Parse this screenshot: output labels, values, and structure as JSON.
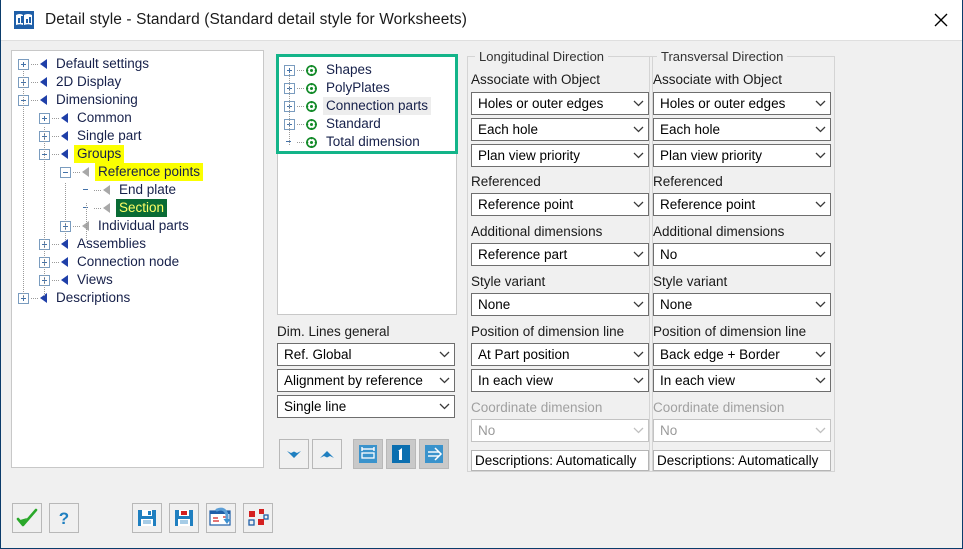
{
  "window": {
    "title": "Detail style - Standard (Standard detail style for Worksheets)",
    "icon": "book-chart-icon",
    "close_label": "×",
    "accent_green": "#13b489",
    "highlight_yellow": "#fbff00",
    "selection_green": "#0a6b35",
    "tree_text_color": "#16204a"
  },
  "tree": {
    "name": "settings-tree",
    "items": [
      {
        "label": "Default settings",
        "depth": 0,
        "expander": "plus",
        "marker": "blue-triangle",
        "highlight": "none"
      },
      {
        "label": "2D Display",
        "depth": 0,
        "expander": "plus",
        "marker": "blue-triangle",
        "highlight": "none"
      },
      {
        "label": "Dimensioning",
        "depth": 0,
        "expander": "minus",
        "marker": "blue-triangle",
        "highlight": "none"
      },
      {
        "label": "Common",
        "depth": 1,
        "expander": "plus",
        "marker": "blue-triangle",
        "highlight": "none"
      },
      {
        "label": "Single part",
        "depth": 1,
        "expander": "plus",
        "marker": "blue-triangle",
        "highlight": "none"
      },
      {
        "label": "Groups",
        "depth": 1,
        "expander": "minus",
        "marker": "blue-triangle",
        "highlight": "yellow"
      },
      {
        "label": "Reference points",
        "depth": 2,
        "expander": "minus",
        "marker": "gray-triangle",
        "highlight": "yellow"
      },
      {
        "label": "End plate",
        "depth": 3,
        "expander": "none",
        "marker": "gray-triangle",
        "highlight": "none"
      },
      {
        "label": "Section",
        "depth": 3,
        "expander": "none",
        "marker": "gray-triangle",
        "highlight": "green"
      },
      {
        "label": "Individual parts",
        "depth": 2,
        "expander": "plus",
        "marker": "gray-triangle",
        "highlight": "none"
      },
      {
        "label": "Assemblies",
        "depth": 1,
        "expander": "plus",
        "marker": "blue-triangle",
        "highlight": "none"
      },
      {
        "label": "Connection node",
        "depth": 1,
        "expander": "plus",
        "marker": "blue-triangle",
        "highlight": "none"
      },
      {
        "label": "Views",
        "depth": 1,
        "expander": "plus",
        "marker": "blue-triangle",
        "highlight": "none"
      },
      {
        "label": "Descriptions",
        "depth": 0,
        "expander": "plus",
        "marker": "blue-triangle",
        "highlight": "none"
      }
    ]
  },
  "object_list": {
    "name": "object-list",
    "items": [
      {
        "label": "Shapes",
        "expander": "plus",
        "icon": "green-target-icon",
        "selected": false
      },
      {
        "label": "PolyPlates",
        "expander": "plus",
        "icon": "green-target-icon",
        "selected": false
      },
      {
        "label": "Connection parts",
        "expander": "plus",
        "icon": "green-target-icon",
        "selected": true
      },
      {
        "label": "Standard",
        "expander": "plus",
        "icon": "green-target-icon",
        "selected": false
      },
      {
        "label": "Total dimension",
        "expander": "none",
        "icon": "green-target-icon",
        "selected": false
      }
    ]
  },
  "dim_lines": {
    "title": "Dim. Lines general",
    "combos": [
      {
        "name": "reference-mode-combo",
        "value": "Ref. Global"
      },
      {
        "name": "alignment-combo",
        "value": "Alignment by reference"
      },
      {
        "name": "line-type-combo",
        "value": "Single line"
      }
    ],
    "buttons": [
      {
        "name": "arrow-down-button",
        "icon": "chevron-down-icon",
        "active": false
      },
      {
        "name": "arrow-up-button",
        "icon": "chevron-up-icon",
        "active": false
      },
      {
        "name": "dimension-line-button",
        "icon": "dim-line-icon",
        "active": true
      },
      {
        "name": "dimension-one-button",
        "icon": "number-one-icon",
        "active": true
      },
      {
        "name": "dimension-arrow-button",
        "icon": "arrow-right-icon",
        "active": true
      }
    ]
  },
  "longitudinal": {
    "group_title": "Longitudinal Direction",
    "labels": {
      "associate": "Associate with Object",
      "referenced": "Referenced",
      "additional": "Additional dimensions",
      "style_variant": "Style variant",
      "position": "Position of dimension line",
      "coordinate": "Coordinate dimension"
    },
    "combos": {
      "associate_1": "Holes or outer edges",
      "associate_2": "Each hole",
      "associate_3": "Plan view priority",
      "referenced": "Reference point",
      "additional": "Reference part",
      "style_variant": "None",
      "position_1": "At Part position",
      "position_2": "In each view",
      "coordinate": "No"
    },
    "descriptions": "Descriptions: Automatically"
  },
  "transversal": {
    "group_title": "Transversal Direction",
    "labels": {
      "associate": "Associate with Object",
      "referenced": "Referenced",
      "additional": "Additional dimensions",
      "style_variant": "Style variant",
      "position": "Position of dimension line",
      "coordinate": "Coordinate dimension"
    },
    "combos": {
      "associate_1": "Holes or outer edges",
      "associate_2": "Each hole",
      "associate_3": "Plan view priority",
      "referenced": "Reference point",
      "additional": "No",
      "style_variant": "None",
      "position_1": "Back edge + Border",
      "position_2": "In each view",
      "coordinate": "No"
    },
    "descriptions": "Descriptions: Automatically"
  },
  "bottom_bar": {
    "buttons": [
      {
        "name": "ok-button",
        "icon": "green-check-icon"
      },
      {
        "name": "help-button",
        "icon": "question-mark-icon"
      },
      {
        "name": "save-button",
        "icon": "floppy-save-icon"
      },
      {
        "name": "save-as-button",
        "icon": "floppy-save-red-icon"
      },
      {
        "name": "reload-button",
        "icon": "reload-arrow-icon"
      },
      {
        "name": "properties-button",
        "icon": "red-squares-icon"
      }
    ]
  }
}
